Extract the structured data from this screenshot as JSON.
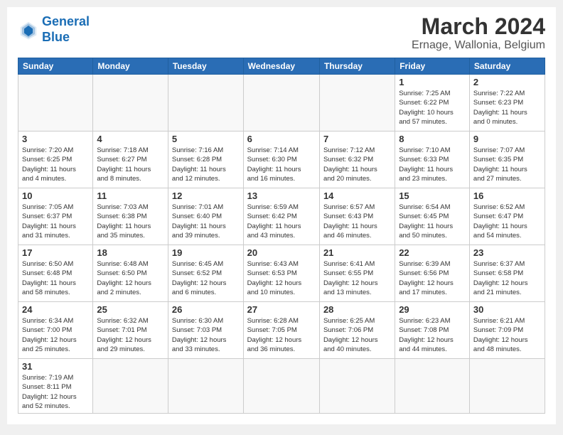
{
  "header": {
    "logo_general": "General",
    "logo_blue": "Blue",
    "month_year": "March 2024",
    "location": "Ernage, Wallonia, Belgium"
  },
  "weekdays": [
    "Sunday",
    "Monday",
    "Tuesday",
    "Wednesday",
    "Thursday",
    "Friday",
    "Saturday"
  ],
  "weeks": [
    [
      {
        "day": "",
        "info": ""
      },
      {
        "day": "",
        "info": ""
      },
      {
        "day": "",
        "info": ""
      },
      {
        "day": "",
        "info": ""
      },
      {
        "day": "",
        "info": ""
      },
      {
        "day": "1",
        "info": "Sunrise: 7:25 AM\nSunset: 6:22 PM\nDaylight: 10 hours\nand 57 minutes."
      },
      {
        "day": "2",
        "info": "Sunrise: 7:22 AM\nSunset: 6:23 PM\nDaylight: 11 hours\nand 0 minutes."
      }
    ],
    [
      {
        "day": "3",
        "info": "Sunrise: 7:20 AM\nSunset: 6:25 PM\nDaylight: 11 hours\nand 4 minutes."
      },
      {
        "day": "4",
        "info": "Sunrise: 7:18 AM\nSunset: 6:27 PM\nDaylight: 11 hours\nand 8 minutes."
      },
      {
        "day": "5",
        "info": "Sunrise: 7:16 AM\nSunset: 6:28 PM\nDaylight: 11 hours\nand 12 minutes."
      },
      {
        "day": "6",
        "info": "Sunrise: 7:14 AM\nSunset: 6:30 PM\nDaylight: 11 hours\nand 16 minutes."
      },
      {
        "day": "7",
        "info": "Sunrise: 7:12 AM\nSunset: 6:32 PM\nDaylight: 11 hours\nand 20 minutes."
      },
      {
        "day": "8",
        "info": "Sunrise: 7:10 AM\nSunset: 6:33 PM\nDaylight: 11 hours\nand 23 minutes."
      },
      {
        "day": "9",
        "info": "Sunrise: 7:07 AM\nSunset: 6:35 PM\nDaylight: 11 hours\nand 27 minutes."
      }
    ],
    [
      {
        "day": "10",
        "info": "Sunrise: 7:05 AM\nSunset: 6:37 PM\nDaylight: 11 hours\nand 31 minutes."
      },
      {
        "day": "11",
        "info": "Sunrise: 7:03 AM\nSunset: 6:38 PM\nDaylight: 11 hours\nand 35 minutes."
      },
      {
        "day": "12",
        "info": "Sunrise: 7:01 AM\nSunset: 6:40 PM\nDaylight: 11 hours\nand 39 minutes."
      },
      {
        "day": "13",
        "info": "Sunrise: 6:59 AM\nSunset: 6:42 PM\nDaylight: 11 hours\nand 43 minutes."
      },
      {
        "day": "14",
        "info": "Sunrise: 6:57 AM\nSunset: 6:43 PM\nDaylight: 11 hours\nand 46 minutes."
      },
      {
        "day": "15",
        "info": "Sunrise: 6:54 AM\nSunset: 6:45 PM\nDaylight: 11 hours\nand 50 minutes."
      },
      {
        "day": "16",
        "info": "Sunrise: 6:52 AM\nSunset: 6:47 PM\nDaylight: 11 hours\nand 54 minutes."
      }
    ],
    [
      {
        "day": "17",
        "info": "Sunrise: 6:50 AM\nSunset: 6:48 PM\nDaylight: 11 hours\nand 58 minutes."
      },
      {
        "day": "18",
        "info": "Sunrise: 6:48 AM\nSunset: 6:50 PM\nDaylight: 12 hours\nand 2 minutes."
      },
      {
        "day": "19",
        "info": "Sunrise: 6:45 AM\nSunset: 6:52 PM\nDaylight: 12 hours\nand 6 minutes."
      },
      {
        "day": "20",
        "info": "Sunrise: 6:43 AM\nSunset: 6:53 PM\nDaylight: 12 hours\nand 10 minutes."
      },
      {
        "day": "21",
        "info": "Sunrise: 6:41 AM\nSunset: 6:55 PM\nDaylight: 12 hours\nand 13 minutes."
      },
      {
        "day": "22",
        "info": "Sunrise: 6:39 AM\nSunset: 6:56 PM\nDaylight: 12 hours\nand 17 minutes."
      },
      {
        "day": "23",
        "info": "Sunrise: 6:37 AM\nSunset: 6:58 PM\nDaylight: 12 hours\nand 21 minutes."
      }
    ],
    [
      {
        "day": "24",
        "info": "Sunrise: 6:34 AM\nSunset: 7:00 PM\nDaylight: 12 hours\nand 25 minutes."
      },
      {
        "day": "25",
        "info": "Sunrise: 6:32 AM\nSunset: 7:01 PM\nDaylight: 12 hours\nand 29 minutes."
      },
      {
        "day": "26",
        "info": "Sunrise: 6:30 AM\nSunset: 7:03 PM\nDaylight: 12 hours\nand 33 minutes."
      },
      {
        "day": "27",
        "info": "Sunrise: 6:28 AM\nSunset: 7:05 PM\nDaylight: 12 hours\nand 36 minutes."
      },
      {
        "day": "28",
        "info": "Sunrise: 6:25 AM\nSunset: 7:06 PM\nDaylight: 12 hours\nand 40 minutes."
      },
      {
        "day": "29",
        "info": "Sunrise: 6:23 AM\nSunset: 7:08 PM\nDaylight: 12 hours\nand 44 minutes."
      },
      {
        "day": "30",
        "info": "Sunrise: 6:21 AM\nSunset: 7:09 PM\nDaylight: 12 hours\nand 48 minutes."
      }
    ],
    [
      {
        "day": "31",
        "info": "Sunrise: 7:19 AM\nSunset: 8:11 PM\nDaylight: 12 hours\nand 52 minutes."
      },
      {
        "day": "",
        "info": ""
      },
      {
        "day": "",
        "info": ""
      },
      {
        "day": "",
        "info": ""
      },
      {
        "day": "",
        "info": ""
      },
      {
        "day": "",
        "info": ""
      },
      {
        "day": "",
        "info": ""
      }
    ]
  ]
}
